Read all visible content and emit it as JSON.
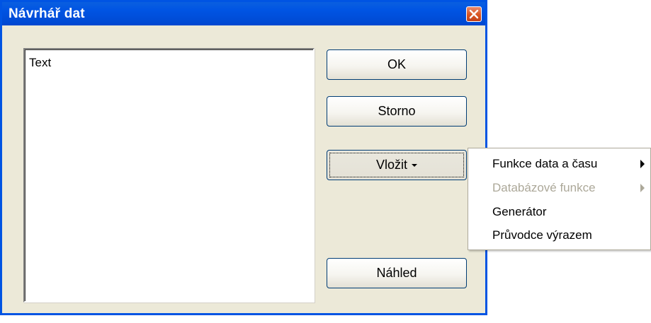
{
  "window": {
    "title": "Návrhář dat"
  },
  "editor": {
    "text": "Text"
  },
  "buttons": {
    "ok": "OK",
    "cancel": "Storno",
    "insert": "Vložit",
    "preview": "Náhled"
  },
  "insert_menu": {
    "items": [
      {
        "label": "Funkce data a času",
        "enabled": true,
        "has_submenu": true
      },
      {
        "label": "Databázové funkce",
        "enabled": false,
        "has_submenu": true
      },
      {
        "label": "Generátor",
        "enabled": true,
        "has_submenu": false
      },
      {
        "label": "Průvodce výrazem",
        "enabled": true,
        "has_submenu": false
      }
    ]
  },
  "colors": {
    "titlebar": "#0054e3",
    "window_bg": "#ece9d8",
    "close_button": "#d9541f",
    "disabled_text": "#aca899"
  },
  "icons": {
    "close": "close-x-icon",
    "insert_dropdown": "triangle-down-icon",
    "submenu": "triangle-right-icon"
  }
}
